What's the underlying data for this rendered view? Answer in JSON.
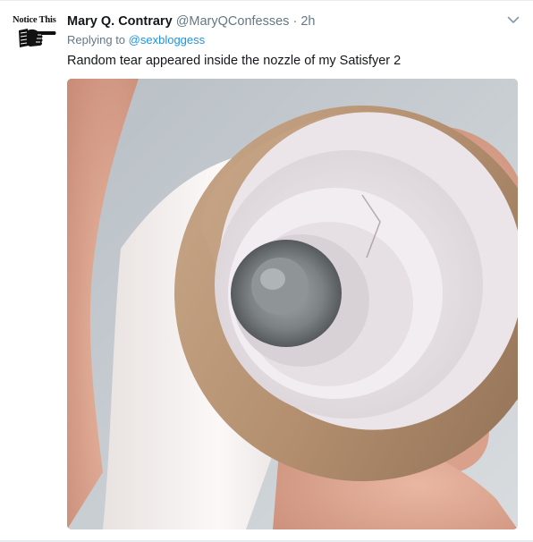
{
  "author": {
    "avatar_text": "Notice This",
    "avatar_icon": "pointing-hand-icon",
    "display_name": "Mary Q. Contrary",
    "handle": "@MaryQConfesses",
    "separator": "·",
    "timestamp": "2h"
  },
  "reply": {
    "prefix": "Replying to",
    "handle": "@sexbloggess"
  },
  "tweet": {
    "text": "Random tear appeared inside the nozzle of my Satisfyer 2"
  },
  "media": {
    "type": "photo"
  },
  "icons": {
    "more_menu": "chevron-down-icon"
  },
  "colors": {
    "text_primary": "#14171a",
    "text_secondary": "#657786",
    "link": "#1b95e0",
    "divider": "#e6ecf0"
  }
}
